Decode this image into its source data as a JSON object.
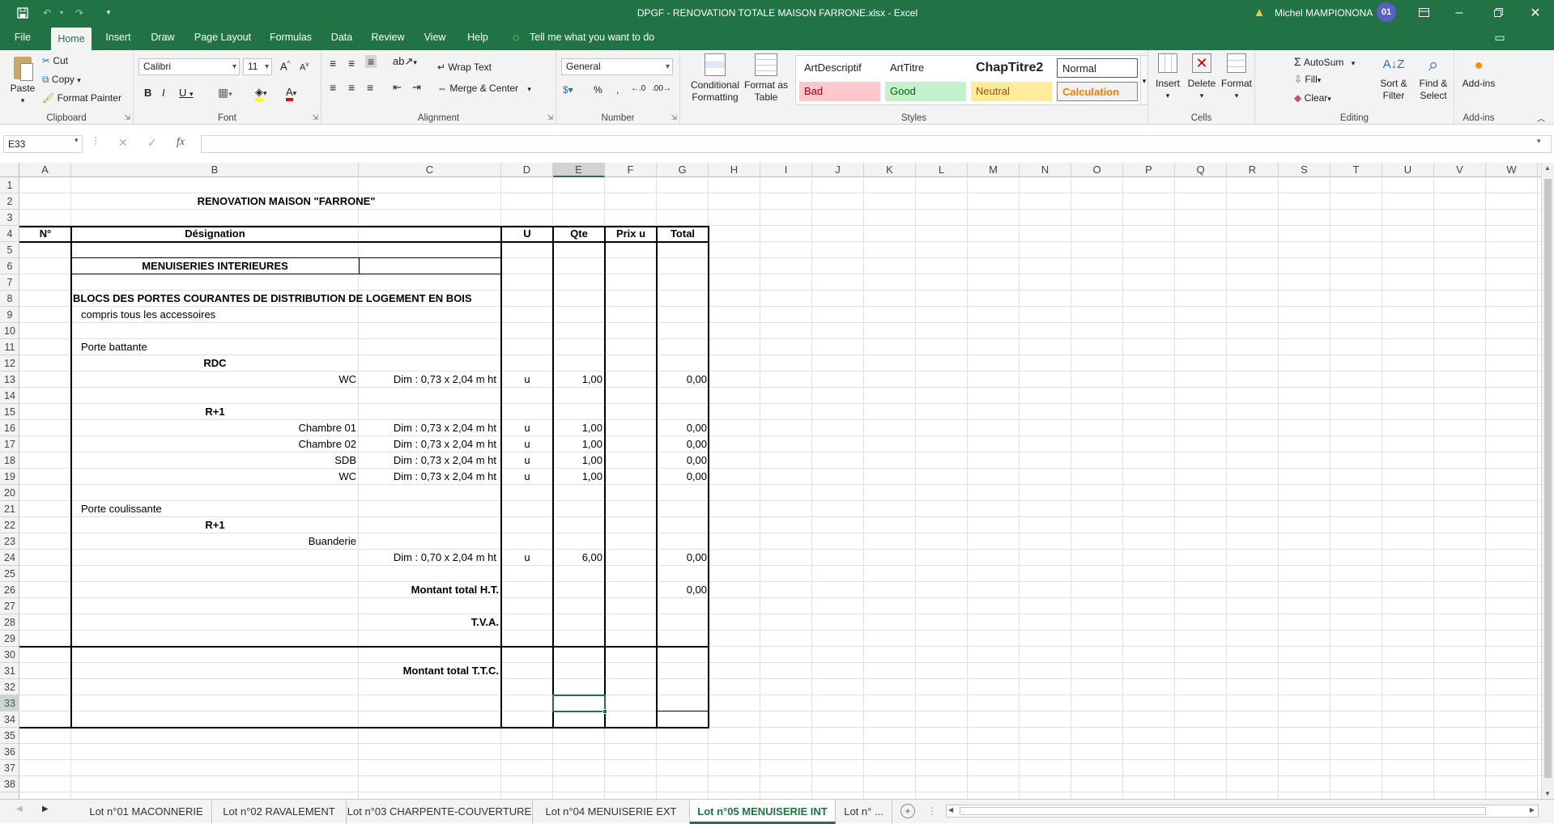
{
  "window": {
    "title": "DPGF - RENOVATION TOTALE MAISON FARRONE.xlsx  -  Excel",
    "user_name": "Michel MAMPIONONA",
    "user_initials": "01"
  },
  "ribbon_tabs": [
    "File",
    "Home",
    "Insert",
    "Draw",
    "Page Layout",
    "Formulas",
    "Data",
    "Review",
    "View",
    "Help"
  ],
  "tell_me": "Tell me what you want to do",
  "clipboard": {
    "paste": "Paste",
    "cut": "Cut",
    "copy": "Copy",
    "format_painter": "Format Painter",
    "label": "Clipboard"
  },
  "font": {
    "name": "Calibri",
    "size": "11",
    "label": "Font"
  },
  "alignment": {
    "wrap_text": "Wrap Text",
    "merge_center": "Merge & Center",
    "label": "Alignment"
  },
  "number": {
    "format": "General",
    "label": "Number"
  },
  "styles_group": {
    "conditional_formatting": "Conditional Formatting",
    "format_as_table": "Format as Table",
    "label": "Styles",
    "cells": [
      {
        "name": "ArtDescriptif",
        "bg": "#ffffff",
        "fg": "#000000"
      },
      {
        "name": "ArtTitre",
        "bg": "#ffffff",
        "fg": "#000000"
      },
      {
        "name": "ChapTitre2",
        "bg": "#ffffff",
        "fg": "#000000"
      },
      {
        "name": "Normal",
        "bg": "#ffffff",
        "fg": "#000000"
      },
      {
        "name": "Bad",
        "bg": "#ffc7ce",
        "fg": "#9c0006"
      },
      {
        "name": "Good",
        "bg": "#c6efce",
        "fg": "#006100"
      },
      {
        "name": "Neutral",
        "bg": "#ffeb9c",
        "fg": "#9c5700"
      },
      {
        "name": "Calculation",
        "bg": "#f2f2f2",
        "fg": "#fa7d00"
      }
    ]
  },
  "cells_group": {
    "insert": "Insert",
    "delete": "Delete",
    "format": "Format",
    "label": "Cells"
  },
  "editing_group": {
    "autosum": "AutoSum",
    "fill": "Fill",
    "clear": "Clear",
    "sort_filter": "Sort & Filter",
    "find_select": "Find & Select",
    "label": "Editing"
  },
  "addins_group": {
    "addins": "Add-ins",
    "label": "Add-ins"
  },
  "formula_bar": {
    "name_box": "E33",
    "fx": "fx",
    "formula": ""
  },
  "columns": [
    "A",
    "B",
    "C",
    "D",
    "E",
    "F",
    "G",
    "H",
    "I",
    "J",
    "K",
    "L",
    "M",
    "N",
    "O",
    "P",
    "Q",
    "R",
    "S",
    "T",
    "U",
    "V",
    "W"
  ],
  "selected_column": "E",
  "rows": [
    "1",
    "2",
    "3",
    "4",
    "5",
    "6",
    "7",
    "8",
    "9",
    "10",
    "11",
    "12",
    "13",
    "14",
    "15",
    "16",
    "17",
    "18",
    "19",
    "20",
    "21",
    "22",
    "23",
    "24",
    "25",
    "26",
    "27",
    "28",
    "29",
    "30",
    "31",
    "32",
    "33",
    "34",
    "35",
    "36",
    "37",
    "38"
  ],
  "selected_row": "33",
  "sheet": {
    "title": "RENOVATION MAISON \"FARRONE\"",
    "headers": {
      "num": "N°",
      "designation": "Désignation",
      "u": "U",
      "qte": "Qte",
      "prix": "Prix u",
      "total": "Total"
    },
    "chapter": "MENUISERIES INTERIEURES",
    "section_title": "BLOCS DES PORTES COURANTES DE DISTRIBUTION DE LOGEMENT EN BOIS",
    "section_sub": "compris tous les accessoires",
    "porte_battante": "Porte battante",
    "rdc": "RDC",
    "r1a": "R+1",
    "porte_coulissante": "Porte coulissante",
    "r1b": "R+1",
    "buanderie": "Buanderie",
    "items": [
      {
        "name": "WC",
        "dim": "Dim : 0,73 x 2,04 m ht",
        "u": "u",
        "qte": "1,00",
        "total": "0,00"
      },
      {
        "name": "Chambre 01",
        "dim": "Dim : 0,73 x 2,04 m ht",
        "u": "u",
        "qte": "1,00",
        "total": "0,00"
      },
      {
        "name": "Chambre 02",
        "dim": "Dim : 0,73 x 2,04 m ht",
        "u": "u",
        "qte": "1,00",
        "total": "0,00"
      },
      {
        "name": "SDB",
        "dim": "Dim : 0,73 x 2,04 m ht",
        "u": "u",
        "qte": "1,00",
        "total": "0,00"
      },
      {
        "name": "WC",
        "dim": "Dim : 0,73 x 2,04 m ht",
        "u": "u",
        "qte": "1,00",
        "total": "0,00"
      },
      {
        "name": "",
        "dim": "Dim : 0,70 x 2,04 m ht",
        "u": "u",
        "qte": "6,00",
        "total": "0,00"
      }
    ],
    "montant_ht": "Montant total H.T.",
    "montant_ht_value": "0,00",
    "tva": "T.V.A.",
    "montant_ttc": "Montant total T.T.C."
  },
  "sheet_tabs": [
    "Lot n°01 MACONNERIE",
    "Lot n°02 RAVALEMENT",
    "Lot n°03 CHARPENTE-COUVERTURE",
    "Lot n°04 MENUISERIE EXT",
    "Lot n°05 MENUISERIE INT",
    "Lot n° ..."
  ],
  "active_sheet_tab": "Lot n°05 MENUISERIE INT"
}
